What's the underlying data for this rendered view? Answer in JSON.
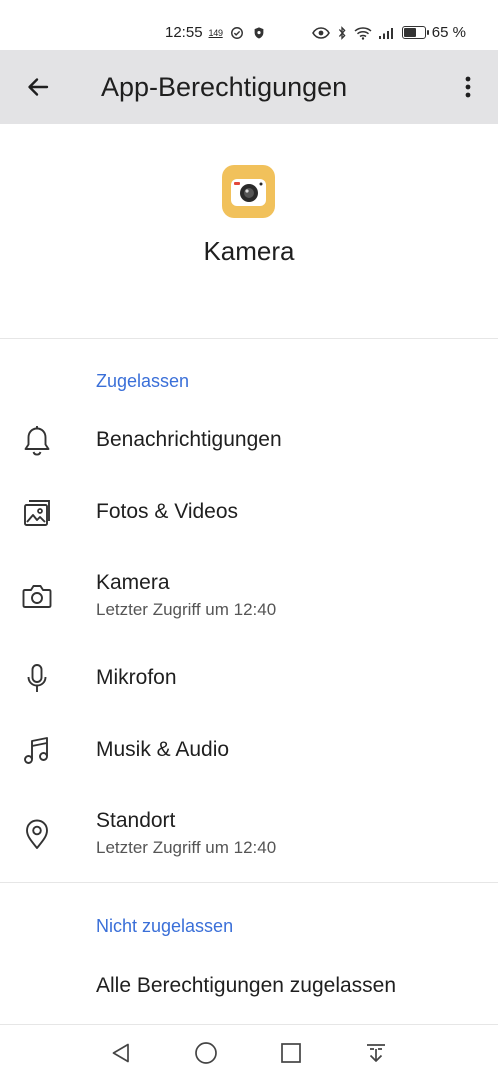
{
  "status_bar": {
    "time": "12:55",
    "notification_count": "149",
    "battery_percent": "65 %",
    "battery_level": 0.65,
    "icons": [
      "check-circle-icon",
      "shield-icon",
      "eye-icon",
      "bluetooth-icon",
      "wifi-icon",
      "signal-icon",
      "battery-icon"
    ]
  },
  "app_bar": {
    "title": "App-Berechtigungen",
    "back_icon": "arrow-left-icon",
    "menu_icon": "more-vert-icon"
  },
  "app": {
    "name": "Kamera",
    "icon": "camera-app-icon",
    "icon_color": "#f1c15b"
  },
  "allowed": {
    "header": "Zugelassen",
    "items": [
      {
        "title": "Benachrichtigungen",
        "icon": "bell-icon"
      },
      {
        "title": "Fotos & Videos",
        "icon": "photo-icon"
      },
      {
        "title": "Kamera",
        "subtitle": "Letzter Zugriff um 12:40",
        "icon": "camera-icon"
      },
      {
        "title": "Mikrofon",
        "icon": "microphone-icon"
      },
      {
        "title": "Musik & Audio",
        "icon": "music-note-icon"
      },
      {
        "title": "Standort",
        "subtitle": "Letzter Zugriff um 12:40",
        "icon": "location-icon"
      }
    ]
  },
  "not_allowed": {
    "header": "Nicht zugelassen",
    "items": [
      {
        "title": "Alle Berechtigungen zugelassen"
      }
    ]
  },
  "nav_bar": {
    "icons": [
      "nav-back-icon",
      "nav-home-icon",
      "nav-recents-icon",
      "nav-notifications-icon"
    ]
  },
  "colors": {
    "accent": "#3a6fd8",
    "app_bar_bg": "#e3e3e5"
  }
}
